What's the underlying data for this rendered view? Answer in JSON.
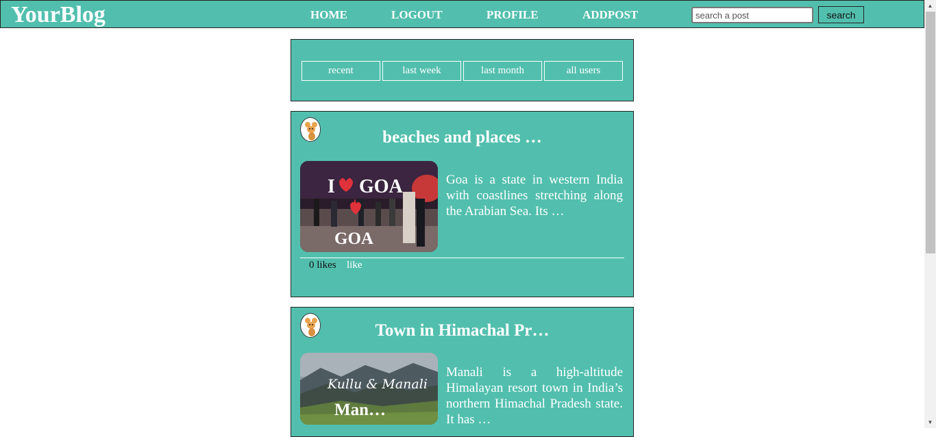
{
  "nav": {
    "brand": "YourBlog",
    "links": [
      "HOME",
      "LOGOUT",
      "PROFILE",
      "ADDPOST"
    ],
    "search_placeholder": "search a post",
    "search_button": "search"
  },
  "filters": [
    "recent",
    "last week",
    "last month",
    "all users"
  ],
  "posts": [
    {
      "title": "beaches and places …",
      "excerpt": "Goa is a state in western India with coastlines stretching along the Arabian Sea. Its …",
      "image_text_top": "I",
      "image_text_top2": "GOA",
      "image_text_bottom": "GOA",
      "likes_label": "0 likes",
      "like_action": "like"
    },
    {
      "title": "Town in Himachal Pr…",
      "excerpt": "Manali is a high-altitude Himalayan resort town in India’s northern Himachal Pradesh state. It has …",
      "image_text_script": "Kullu & Manali",
      "image_text_bottom": "Man…"
    }
  ],
  "colors": {
    "teal": "#52bfae",
    "white": "#ffffff",
    "border": "#222222"
  }
}
